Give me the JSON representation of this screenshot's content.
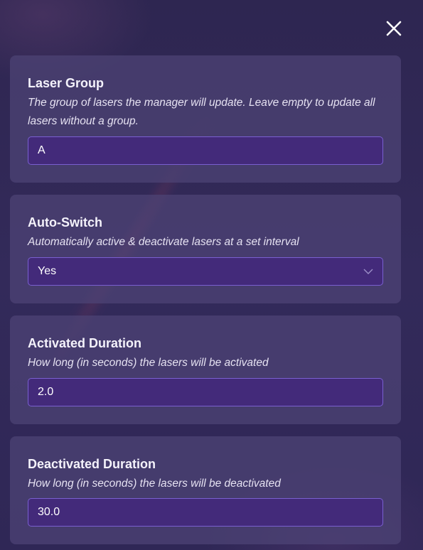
{
  "dialog": {
    "close_icon": "close-icon"
  },
  "sections": {
    "laser_group": {
      "title": "Laser Group",
      "description": "The group of lasers the manager will update. Leave empty to update all lasers without a group.",
      "value": "A"
    },
    "auto_switch": {
      "title": "Auto-Switch",
      "description": "Automatically active & deactivate lasers at a set interval",
      "selected": "Yes",
      "icon": "chevron-down-icon"
    },
    "activated_duration": {
      "title": "Activated Duration",
      "description": "How long (in seconds) the lasers will be activated",
      "value": "2.0"
    },
    "deactivated_duration": {
      "title": "Deactivated Duration",
      "description": "How long (in seconds) the lasers will be deactivated",
      "value": "30.0"
    }
  },
  "colors": {
    "background": "#2f2753",
    "panel": "#4e4476",
    "field_bg": "#432a7a",
    "field_border": "#7a5fd0"
  }
}
